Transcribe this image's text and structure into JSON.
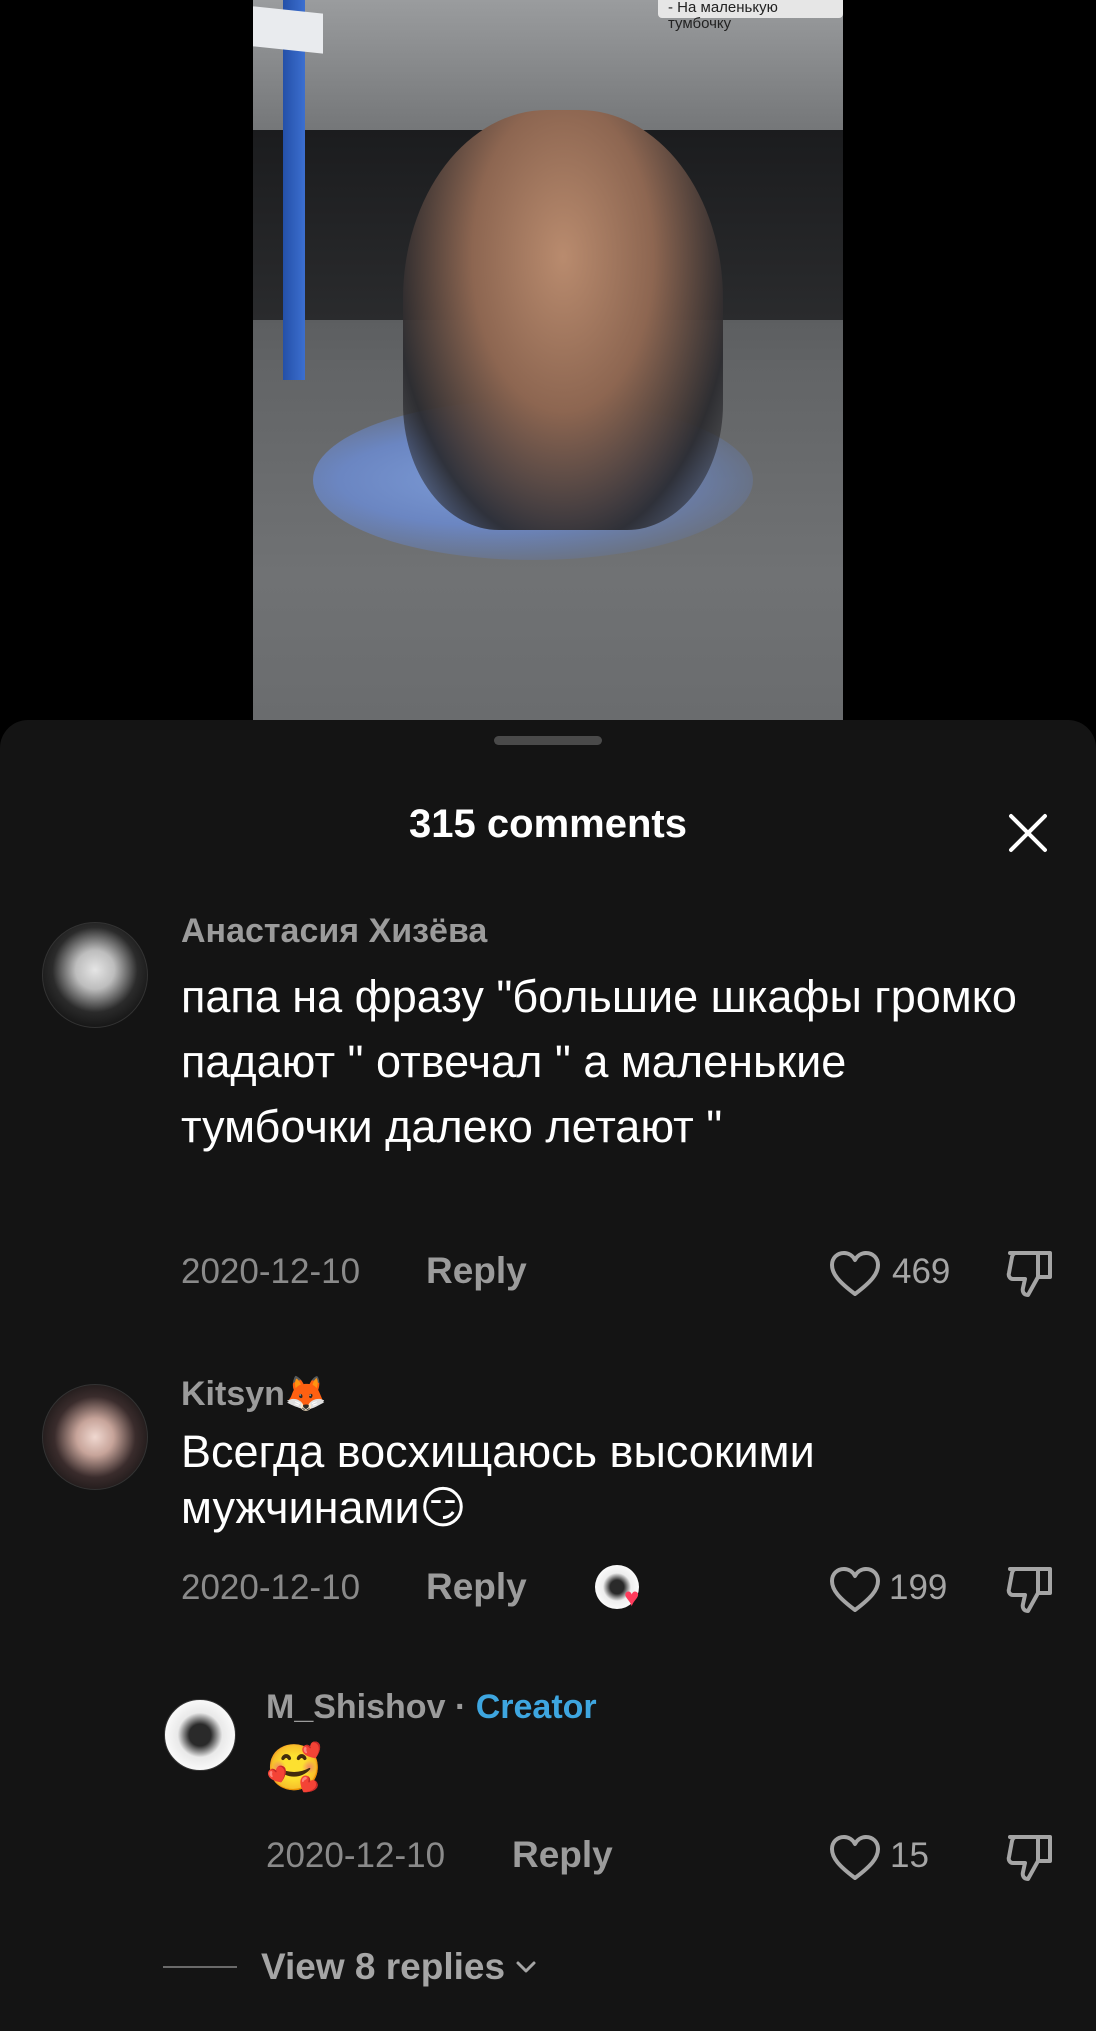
{
  "video": {
    "caption": "- На маленькую тумбочку"
  },
  "sheet": {
    "title": "315 comments"
  },
  "comments": [
    {
      "username": "Анастасия Хизёва",
      "text": "папа на фразу \"большие шкафы громко падают \" отвечал \" а маленькие тумбочки далеко летают \"",
      "date": "2020-12-10",
      "reply_label": "Reply",
      "likes": "469"
    },
    {
      "username": "Kitsyn🦊",
      "text": "Всегда восхищаюсь высокими мужчинами😏",
      "date": "2020-12-10",
      "reply_label": "Reply",
      "likes": "199"
    }
  ],
  "reply": {
    "username": "M_Shishov",
    "separator": "·",
    "creator_label": "Creator",
    "text": "🥰",
    "date": "2020-12-10",
    "reply_label": "Reply",
    "likes": "15"
  },
  "view_replies": {
    "label": "View 8 replies"
  },
  "icons": {
    "close": "close-icon",
    "like": "heart-outline-icon",
    "dislike": "thumbs-down-icon",
    "chevron": "chevron-down-icon"
  }
}
